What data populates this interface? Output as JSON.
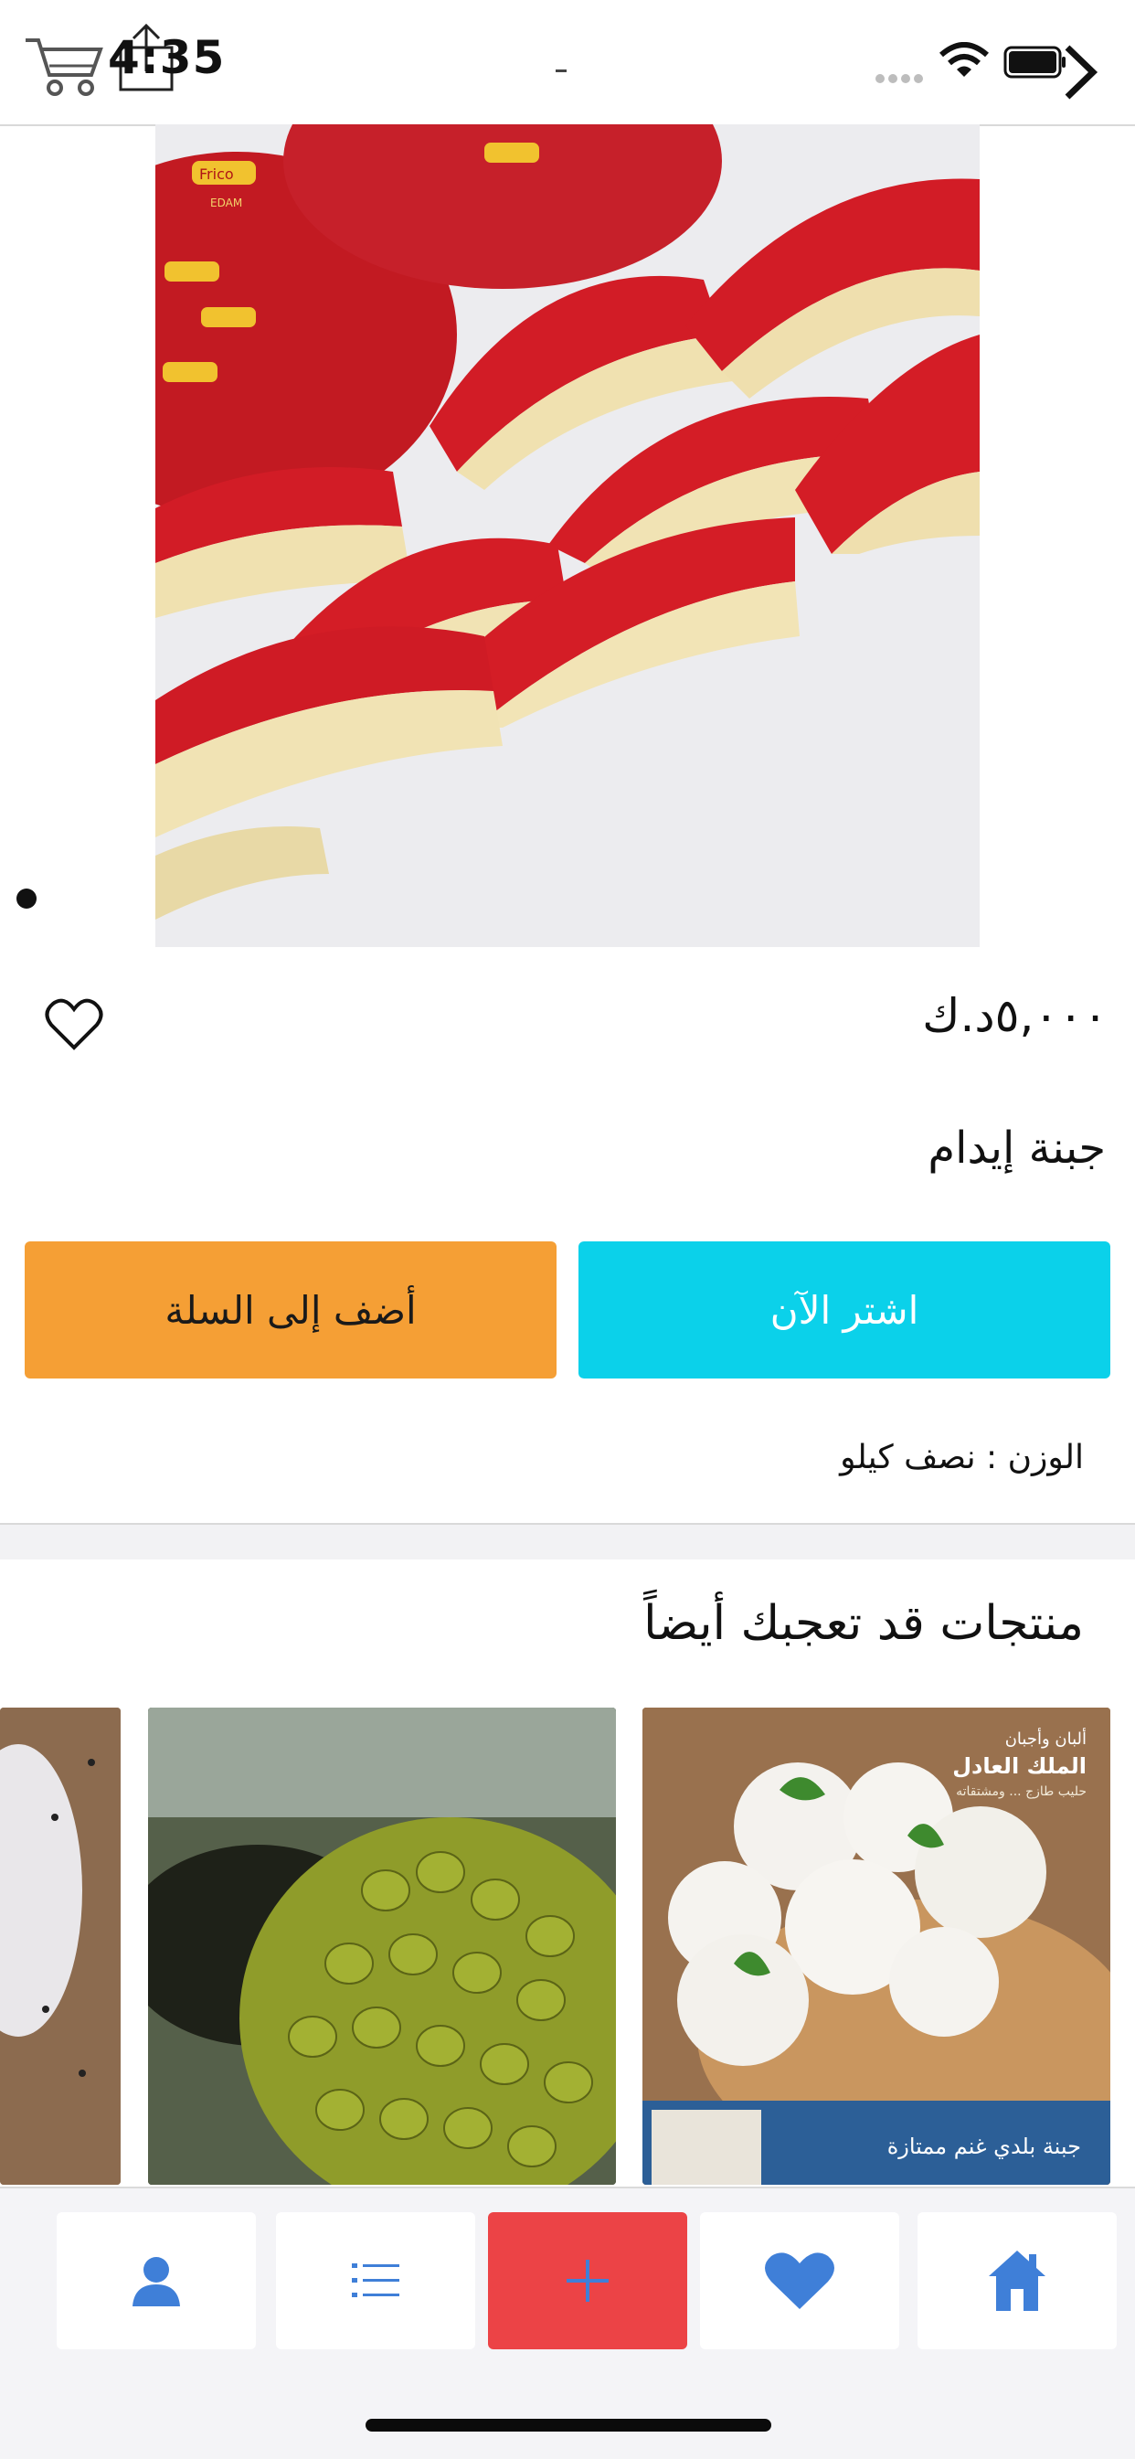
{
  "status_bar": {
    "time": "4:35"
  },
  "product": {
    "price": "٥,٠٠٠د.ك",
    "name": "جبنة إيدام",
    "weight": "الوزن : نصف كيلو",
    "image_text": {
      "brand": "Frico",
      "variety": "EDAM"
    }
  },
  "actions": {
    "add_to_cart": "أضف إلى السلة",
    "buy_now": "اشتر الآن"
  },
  "related": {
    "title": "منتجات قد تعجبك أيضاً",
    "cards": [
      {
        "image": "mozzarella-balls-image",
        "ad_text": {
          "category": "ألبان وأجبان",
          "brand": "الملك العادل",
          "tagline": "حليب طازج ... ومشتقاته",
          "product": "جبنة بلدي غنم ممتازة"
        }
      },
      {
        "image": "green-olives-image"
      },
      {
        "image": "cheese-partial-image"
      }
    ]
  },
  "nav": {
    "items": [
      "user-icon",
      "list-icon",
      "plus-icon",
      "heart-icon",
      "home-icon"
    ]
  },
  "colors": {
    "add_to_cart": "#f59f35",
    "buy_now": "#0bd1ea",
    "nav_add": "#ec4346",
    "nav_icon": "#3f7fd8"
  }
}
